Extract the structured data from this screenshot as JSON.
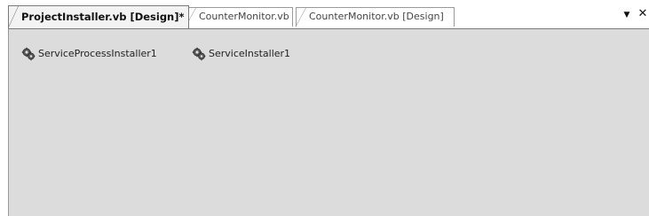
{
  "tabs": [
    {
      "label": "ProjectInstaller.vb [Design]*",
      "active": true
    },
    {
      "label": "CounterMonitor.vb",
      "active": false
    },
    {
      "label": "CounterMonitor.vb [Design]",
      "active": false
    }
  ],
  "window_controls": {
    "dropdown_glyph": "▼",
    "close_glyph": "✕"
  },
  "components": [
    {
      "label": "ServiceProcessInstaller1",
      "icon": "gear-component-icon"
    },
    {
      "label": "ServiceInstaller1",
      "icon": "gear-component-icon"
    }
  ],
  "colors": {
    "designer_background": "#dcdcdc",
    "active_tab_background": "#f3f3f3"
  }
}
